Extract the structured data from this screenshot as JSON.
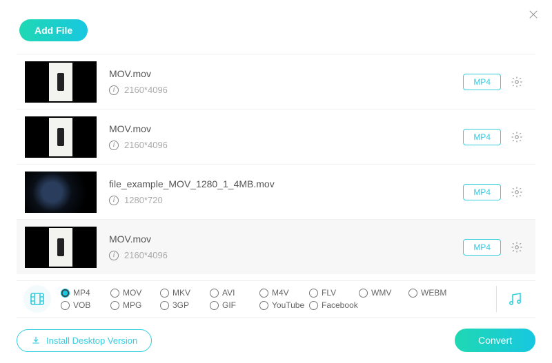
{
  "header": {
    "add_file_label": "Add File"
  },
  "files": [
    {
      "name": "MOV.mov",
      "resolution": "2160*4096",
      "format": "MP4",
      "thumb": "light",
      "selected": false
    },
    {
      "name": "MOV.mov",
      "resolution": "2160*4096",
      "format": "MP4",
      "thumb": "light",
      "selected": false
    },
    {
      "name": "file_example_MOV_1280_1_4MB.mov",
      "resolution": "1280*720",
      "format": "MP4",
      "thumb": "planet",
      "selected": false
    },
    {
      "name": "MOV.mov",
      "resolution": "2160*4096",
      "format": "MP4",
      "thumb": "light",
      "selected": true
    }
  ],
  "format_options": {
    "selected": "MP4",
    "items": [
      "MP4",
      "MOV",
      "MKV",
      "AVI",
      "M4V",
      "FLV",
      "WMV",
      "WEBM",
      "VOB",
      "MPG",
      "3GP",
      "GIF",
      "YouTube",
      "Facebook"
    ]
  },
  "footer": {
    "install_label": "Install Desktop Version",
    "convert_label": "Convert"
  },
  "colors": {
    "accent": "#18c7e0"
  }
}
